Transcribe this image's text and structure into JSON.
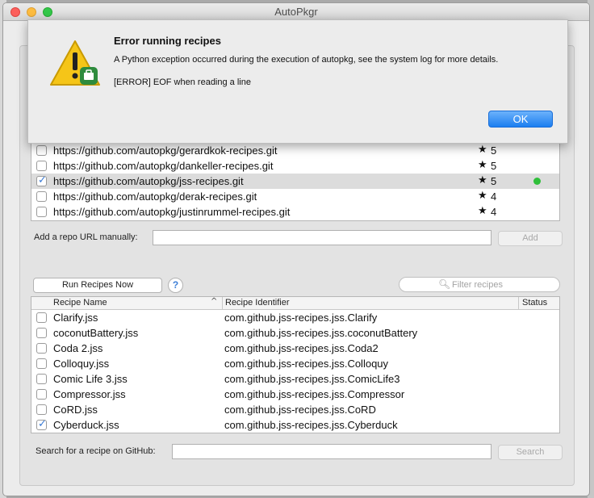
{
  "window": {
    "title": "AutoPkgr"
  },
  "alert": {
    "title": "Error running recipes",
    "message": "A Python exception occurred during the execution of autopkg, see the system log for more details.",
    "error": "[ERROR] EOF when reading a line",
    "ok_label": "OK"
  },
  "repos": [
    {
      "url": "https://github.com/autopkg/gerardkok-recipes.git",
      "star": "★",
      "stars": "5",
      "checked": false,
      "installed": false
    },
    {
      "url": "https://github.com/autopkg/dankeller-recipes.git",
      "star": "★",
      "stars": "5",
      "checked": false,
      "installed": false
    },
    {
      "url": "https://github.com/autopkg/jss-recipes.git",
      "star": "★",
      "stars": "5",
      "checked": true,
      "installed": true
    },
    {
      "url": "https://github.com/autopkg/derak-recipes.git",
      "star": "★",
      "stars": "4",
      "checked": false,
      "installed": false
    },
    {
      "url": "https://github.com/autopkg/justinrummel-recipes.git",
      "star": "★",
      "stars": "4",
      "checked": false,
      "installed": false
    }
  ],
  "add_repo": {
    "label": "Add a repo URL manually:",
    "value": "",
    "button": "Add"
  },
  "run_recipes": {
    "label": "Run Recipes Now",
    "help": "?"
  },
  "filter": {
    "placeholder": "Filter recipes",
    "icon": "search-icon"
  },
  "recipe_table": {
    "columns": [
      "Recipe Name",
      "Recipe Identifier",
      "Status"
    ],
    "sort_indicator": "^",
    "rows": [
      {
        "name": "Clarify.jss",
        "id": "com.github.jss-recipes.jss.Clarify",
        "checked": false
      },
      {
        "name": "coconutBattery.jss",
        "id": "com.github.jss-recipes.jss.coconutBattery",
        "checked": false
      },
      {
        "name": "Coda 2.jss",
        "id": "com.github.jss-recipes.jss.Coda2",
        "checked": false
      },
      {
        "name": "Colloquy.jss",
        "id": "com.github.jss-recipes.jss.Colloquy",
        "checked": false
      },
      {
        "name": "Comic Life 3.jss",
        "id": "com.github.jss-recipes.jss.ComicLife3",
        "checked": false
      },
      {
        "name": "Compressor.jss",
        "id": "com.github.jss-recipes.jss.Compressor",
        "checked": false
      },
      {
        "name": "CoRD.jss",
        "id": "com.github.jss-recipes.jss.CoRD",
        "checked": false
      },
      {
        "name": "Cyberduck.jss",
        "id": "com.github.jss-recipes.jss.Cyberduck",
        "checked": true
      }
    ]
  },
  "github_search": {
    "label": "Search for a recipe on GitHub:",
    "value": "",
    "button": "Search"
  },
  "colors": {
    "ok_button": "#1c7ef0",
    "installed_dot": "#2fbf3a",
    "check": "#3a7bd5"
  }
}
